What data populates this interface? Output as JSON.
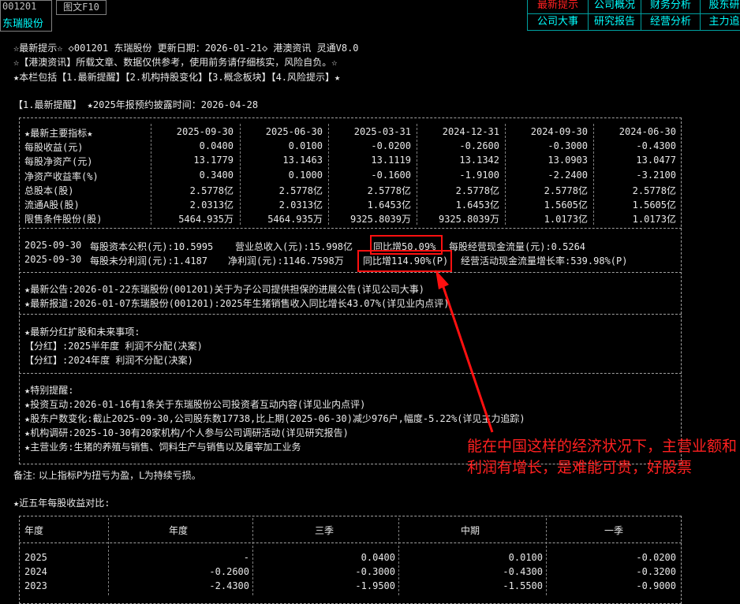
{
  "header": {
    "stock_code": "001201",
    "stock_name": "东瑞股份",
    "f10_button": "图文F10"
  },
  "nav": {
    "row1": [
      "最新提示",
      "公司概况",
      "财务分析",
      "股东研"
    ],
    "row2": [
      "公司大事",
      "研究报告",
      "经营分析",
      "主力追"
    ],
    "active": "最新提示"
  },
  "intro": {
    "line1": "☆最新提示☆ ◇001201 东瑞股份 更新日期：2026-01-21◇ 港澳资讯 灵通V8.0",
    "line2": "☆【港澳资讯】所载文章、数据仅供参考，使用前务请仔细核实，风险自负。☆",
    "line3": "★本栏包括【1.最新提醒】【2.机构持股变化】【3.概念板块】【4.风险提示】★"
  },
  "section1_title": "【1.最新提醒】 ★2025年报预约披露时间：2026-04-28",
  "indicators": {
    "header_label": "★最新主要指标★",
    "columns": [
      "2025-09-30",
      "2025-06-30",
      "2025-03-31",
      "2024-12-31",
      "2024-09-30",
      "2024-06-30"
    ],
    "rows": [
      {
        "label": "每股收益(元)",
        "values": [
          "0.0400",
          "0.0100",
          "-0.0200",
          "-0.2600",
          "-0.3000",
          "-0.4300"
        ]
      },
      {
        "label": "每股净资产(元)",
        "values": [
          "13.1779",
          "13.1463",
          "13.1119",
          "13.1342",
          "13.0903",
          "13.0477"
        ]
      },
      {
        "label": "净资产收益率(%)",
        "values": [
          "0.3400",
          "0.1000",
          "-0.1600",
          "-1.9100",
          "-2.2400",
          "-3.2100"
        ]
      },
      {
        "label": "总股本(股)",
        "values": [
          "2.5778亿",
          "2.5778亿",
          "2.5778亿",
          "2.5778亿",
          "2.5778亿",
          "2.5778亿"
        ]
      },
      {
        "label": "流通A股(股)",
        "values": [
          "2.0313亿",
          "2.0313亿",
          "1.6453亿",
          "1.6453亿",
          "1.5605亿",
          "1.5605亿"
        ]
      },
      {
        "label": "限售条件股份(股)",
        "values": [
          "5464.935万",
          "5464.935万",
          "9325.8039万",
          "9325.8039万",
          "1.0173亿",
          "1.0173亿"
        ]
      }
    ]
  },
  "fin_summary": {
    "line1": {
      "date": "2025-09-30",
      "a": "每股资本公积(元):10.5995",
      "b": "营业总收入(元):15.998亿",
      "c": "同比增50.09%",
      "d": "每股经营现金流量(元):0.5264"
    },
    "line2": {
      "date": "2025-09-30",
      "a": "每股未分利润(元):1.4187",
      "b": "净利润(元):1146.7598万",
      "c": "同比增114.90%(P)",
      "d": "经营活动现金流量增长率:539.98%(P)"
    }
  },
  "news": {
    "line1": "★最新公告:2026-01-22东瑞股份(001201)关于为子公司提供担保的进展公告(详见公司大事)",
    "line2": "★最新报道:2026-01-07东瑞股份(001201):2025年生猪销售收入同比增长43.07%(详见业内点评)"
  },
  "dividend": {
    "title": "★最新分红扩股和未来事项:",
    "line1": "【分红】:2025半年度 利润不分配(决案)",
    "line2": "【分红】:2024年度 利润不分配(决案)"
  },
  "special": {
    "title": "★特别提醒:",
    "line1": "★投资互动:2026-01-16有1条关于东瑞股份公司投资者互动内容(详见业内点评)",
    "line2": "★股东户数变化:截止2025-09-30,公司股东数17738,比上期(2025-06-30)减少976户,幅度-5.22%(详见主力追踪)",
    "line3": "★机构调研:2025-10-30有20家机构/个人参与公司调研活动(详见研究报告)",
    "line4": "★主营业务:生猪的养殖与销售、饲料生产与销售以及屠宰加工业务"
  },
  "note": "备注: 以上指标P为扭亏为盈，L为持续亏损。",
  "eps5y": {
    "title": "★近五年每股收益对比:",
    "columns": [
      "年度",
      "年度",
      "三季",
      "中期",
      "一季"
    ],
    "rows": [
      {
        "year": "2025",
        "values": [
          "-",
          "0.0400",
          "0.0100",
          "-0.0200"
        ]
      },
      {
        "year": "2024",
        "values": [
          "-0.2600",
          "-0.3000",
          "-0.4300",
          "-0.3200"
        ]
      },
      {
        "year": "2023",
        "values": [
          "-2.4300",
          "-1.9500",
          "-1.5500",
          "-0.9000"
        ]
      }
    ]
  },
  "annotation": "能在中国这样的经济状况下，主营业额和利润有增长，是难能可贵，好股票",
  "colors": {
    "background": "#000000",
    "accent_cyan": "#00ffff",
    "accent_yellow": "#ffff00",
    "highlight_red": "#ff2020"
  }
}
